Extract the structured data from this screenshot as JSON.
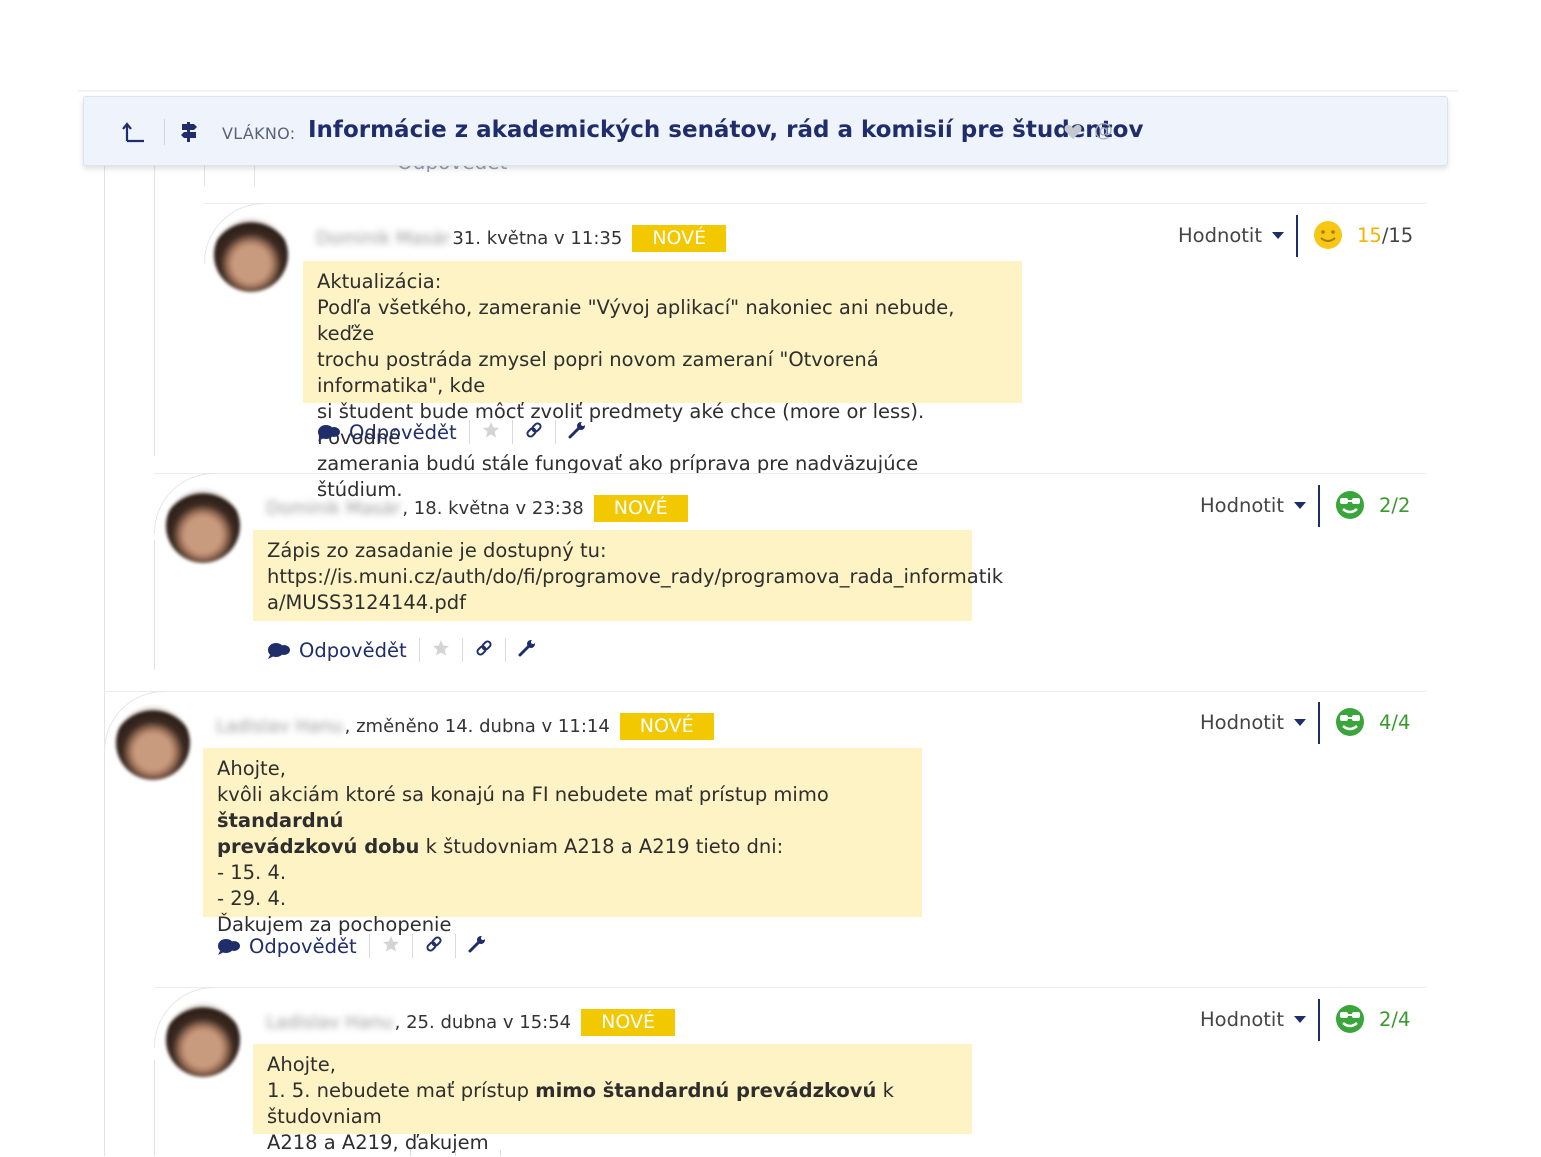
{
  "thread": {
    "label": "VLÁKNO:",
    "title": "Informácie z akademických senátov, rád a komisií pre študentov"
  },
  "peek": {
    "reply_label": "Odpovědět"
  },
  "rate_label": "Hodnotit",
  "reply_label": "Odpovědět",
  "comments": [
    {
      "author": "Dominik Masár",
      "time": "31. května v 11:35",
      "badge": "NOVÉ",
      "lines": [
        "Aktualizácia:",
        "Podľa všetkého, zameranie \"Vývoj aplikací\" nakoniec ani nebude, keďže",
        "trochu postráda zmysel popri novom zameraní \"Otvorená informatika\", kde",
        "si študent bude môcť zvoliť predmety aké chce (more or less). Pôvodné",
        "zamerania budú stále fungovať ako príprava pre nadväzujúce štúdium."
      ],
      "score": {
        "value": "15",
        "total": "/15",
        "icon": "smiley-yellow-icon"
      }
    },
    {
      "author": "Dominik Masár",
      "time": ", 18. května v 23:38",
      "badge": "NOVÉ",
      "lines": [
        "Zápis zo zasadanie je dostupný tu:",
        "https://is.muni.cz/auth/do/fi/programove_rady/programova_rada_informatik",
        "a/MUSS3124144.pdf"
      ],
      "score": {
        "value": "2/2",
        "icon": "smiley-green-icon"
      }
    },
    {
      "author": "Ladislav Hanu",
      "time": ", změněno 14. dubna v 11:14",
      "badge": "NOVÉ",
      "line1": "Ahojte,",
      "line2_pre": "kvôli akciám ktoré sa konajú na FI nebudete mať prístup mimo ",
      "line2_bold": "štandardnú",
      "line3_bold": "prevádzkovú dobu",
      "line3_post": " k študovniam A218 a A219 tieto dni:",
      "line4": "- 15. 4.",
      "line5": "- 29. 4.",
      "line6": "Ďakujem za pochopenie",
      "score": {
        "value": "4/4",
        "icon": "smiley-green-icon"
      }
    },
    {
      "author": "Ladislav Hanu",
      "time": ", 25. dubna v 15:54",
      "badge": "NOVÉ",
      "line1": "Ahojte,",
      "line2_pre": "1. 5. nebudete mať prístup ",
      "line2_bold": "mimo štandardnú prevádzkovú",
      "line2_post": " k študovniam",
      "line3": "A218 a A219, ďakujem",
      "score": {
        "value": "2/4",
        "icon": "smiley-green-icon"
      }
    }
  ]
}
